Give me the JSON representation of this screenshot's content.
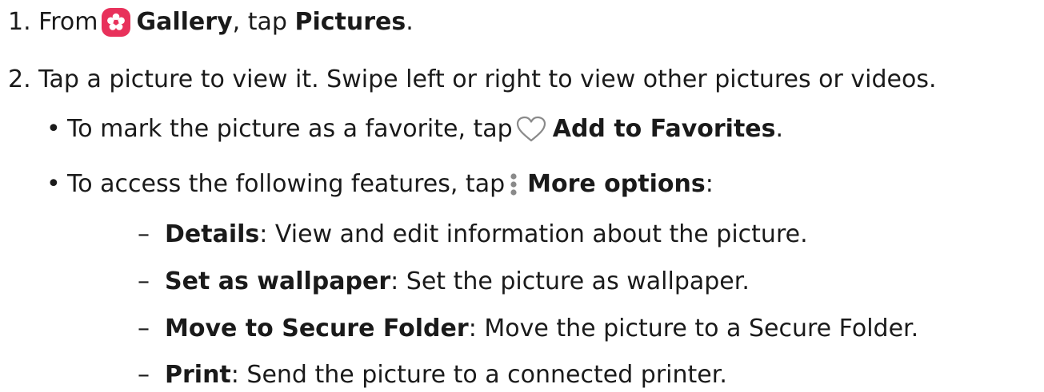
{
  "steps": {
    "step1": {
      "number": "1.",
      "text_a": "From",
      "gallery": "Gallery",
      "text_b": ", tap",
      "pictures": "Pictures",
      "text_c": "."
    },
    "step2": {
      "number": "2.",
      "text": "Tap a picture to view it. Swipe left or right to view other pictures or videos."
    },
    "bullet1": {
      "bullet": "•",
      "text_a": "To mark the picture as a favorite, tap",
      "add_fav": "Add to Favorites",
      "text_b": "."
    },
    "bullet2": {
      "bullet": "•",
      "text_a": "To access the following features, tap",
      "more_options": "More options",
      "text_b": ":"
    },
    "options": [
      {
        "dash": "–",
        "label": "Details",
        "desc": ": View and edit information about the picture."
      },
      {
        "dash": "–",
        "label": "Set as wallpaper",
        "desc": ": Set the picture as wallpaper."
      },
      {
        "dash": "–",
        "label": "Move to Secure Folder",
        "desc": ": Move the picture to a Secure Folder."
      },
      {
        "dash": "–",
        "label": "Print",
        "desc": ": Send the picture to a connected printer."
      }
    ]
  },
  "icons": {
    "gallery": "gallery-icon",
    "heart": "heart-icon",
    "more": "more-options-icon"
  },
  "colors": {
    "text": "#1a1a1a",
    "gallery_icon": "#e8315b",
    "icon_gray": "#8a8a8a"
  }
}
